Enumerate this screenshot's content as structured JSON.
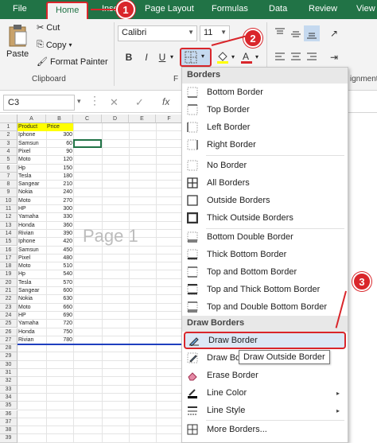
{
  "tabs": {
    "file": "File",
    "home": "Home",
    "insert": "Inser",
    "page_layout": "Page Layout",
    "formulas": "Formulas",
    "data": "Data",
    "review": "Review",
    "view": "View"
  },
  "ribbon": {
    "paste": "Paste",
    "cut": "Cut",
    "copy": "Copy",
    "format_painter": "Format Painter",
    "clipboard_label": "Clipboard",
    "font_name": "Calibri",
    "font_size": "11",
    "bold": "B",
    "italic": "I",
    "underline": "U",
    "font_group_partial": "F",
    "alignment_partial": "ignment"
  },
  "formula_bar": {
    "name_box": "C3",
    "cancel": "✕",
    "enter": "✓",
    "fx": "fx"
  },
  "sheet": {
    "columns": [
      "A",
      "B",
      "C",
      "D",
      "E",
      "F"
    ],
    "header_row": {
      "product": "Product",
      "price": "Price"
    },
    "rows": [
      {
        "product": "Iphone",
        "price": "300"
      },
      {
        "product": "Samsun",
        "price": "60"
      },
      {
        "product": "Pixel",
        "price": "90"
      },
      {
        "product": "Moto",
        "price": "120"
      },
      {
        "product": "Hp",
        "price": "150"
      },
      {
        "product": "Tesla",
        "price": "180"
      },
      {
        "product": "Sangear",
        "price": "210"
      },
      {
        "product": "Nokia",
        "price": "240"
      },
      {
        "product": "Moto",
        "price": "270"
      },
      {
        "product": "HP",
        "price": "300"
      },
      {
        "product": "Yamaha",
        "price": "330"
      },
      {
        "product": "Honda",
        "price": "360"
      },
      {
        "product": "Rivian",
        "price": "390"
      },
      {
        "product": "Iphone",
        "price": "420"
      },
      {
        "product": "Samsun",
        "price": "450"
      },
      {
        "product": "Pixel",
        "price": "480"
      },
      {
        "product": "Moto",
        "price": "510"
      },
      {
        "product": "Hp",
        "price": "540"
      },
      {
        "product": "Tesla",
        "price": "570"
      },
      {
        "product": "Sangear",
        "price": "600"
      },
      {
        "product": "Nokia",
        "price": "630"
      },
      {
        "product": "Moto",
        "price": "660"
      },
      {
        "product": "HP",
        "price": "690"
      },
      {
        "product": "Yamaha",
        "price": "720"
      },
      {
        "product": "Honda",
        "price": "750"
      },
      {
        "product": "Rivian",
        "price": "780"
      }
    ],
    "watermark": "Page 1",
    "row_numbers": [
      "1",
      "2",
      "3",
      "4",
      "5",
      "6",
      "7",
      "8",
      "9",
      "10",
      "11",
      "12",
      "13",
      "14",
      "15",
      "16",
      "17",
      "18",
      "19",
      "20",
      "21",
      "22",
      "23",
      "24",
      "25",
      "26",
      "27",
      "28",
      "29",
      "30",
      "31",
      "32",
      "33",
      "34",
      "35",
      "36",
      "37",
      "38",
      "39"
    ]
  },
  "menu": {
    "borders_header": "Borders",
    "items": [
      "Bottom Border",
      "Top Border",
      "Left Border",
      "Right Border",
      "No Border",
      "All Borders",
      "Outside Borders",
      "Thick Outside Borders",
      "Bottom Double Border",
      "Thick Bottom Border",
      "Top and Bottom Border",
      "Top and Thick Bottom Border",
      "Top and Double Bottom Border"
    ],
    "draw_header": "Draw Borders",
    "draw_items": [
      "Draw Border",
      "Draw Bor",
      "Erase Border",
      "Line Color",
      "Line Style",
      "More Borders..."
    ]
  },
  "tooltip": "Draw Outside Border",
  "callouts": [
    "1",
    "2",
    "3"
  ],
  "colors": {
    "excel_green": "#217346",
    "callout_red": "#d9262b",
    "highlight": "#dde8f5",
    "header_yellow": "#ffff00"
  }
}
